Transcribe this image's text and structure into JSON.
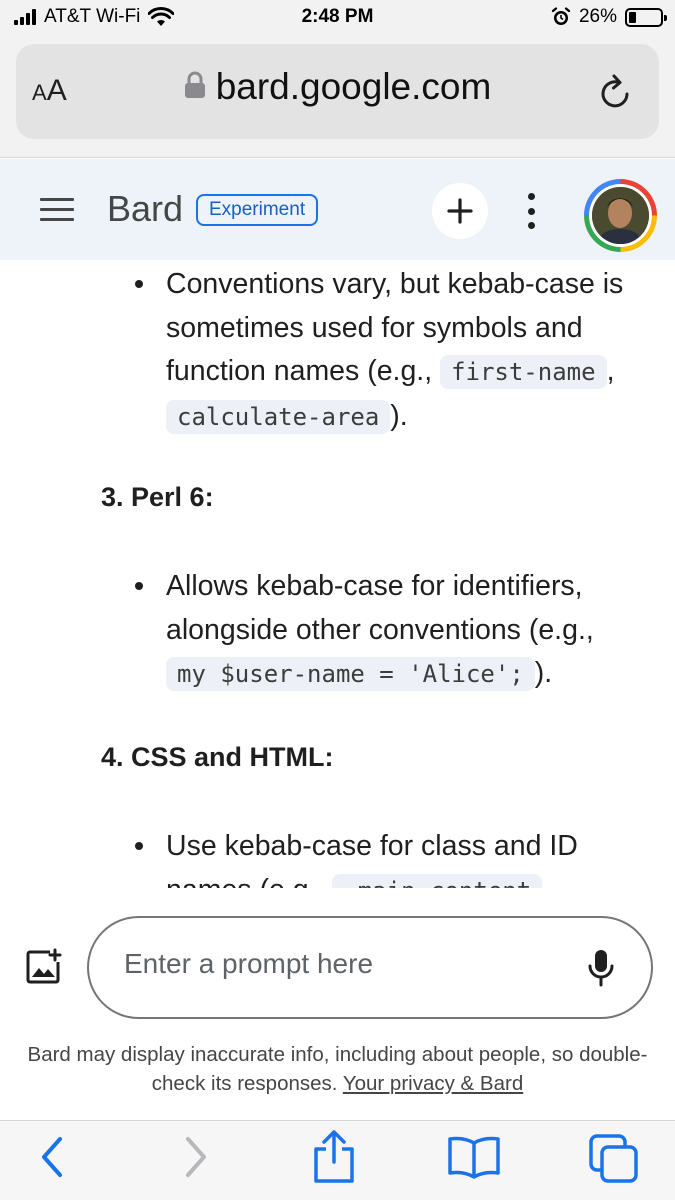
{
  "status_bar": {
    "carrier": "AT&T Wi-Fi",
    "time": "2:48 PM",
    "battery": "26%",
    "battery_level": 0.26
  },
  "address_bar": {
    "text_size_label": "AA",
    "url": "bard.google.com"
  },
  "header": {
    "logo": "Bard",
    "badge": "Experiment"
  },
  "content": {
    "bullet1": {
      "line1": "Conventions vary, but kebab-case is",
      "line2": "sometimes used for symbols and",
      "line3_pre": "function names (e.g., ",
      "code1": "first-name",
      "line3_post": ",",
      "code2": "calculate-area",
      "line4_post": ")."
    },
    "heading3": "3. Perl 6:",
    "bullet2": {
      "line1": "Allows kebab-case for identifiers,",
      "line2": "alongside other conventions (e.g.,",
      "code": "my $user-name = 'Alice';",
      "line3_post": ")."
    },
    "heading4": "4. CSS and HTML:",
    "bullet3": {
      "line1": "Use kebab-case for class and ID",
      "line2_pre": "names (e.g., ",
      "code": ".main-content"
    }
  },
  "prompt": {
    "placeholder": "Enter a prompt here"
  },
  "disclaimer": {
    "text": "Bard may display inaccurate info, including about people, so double-check its responses. ",
    "link": "Your privacy & Bard"
  },
  "colors": {
    "header_bg": "#eef2f9",
    "accent_blue": "#1a73e8",
    "toolbar_icon": "#1a73e8"
  }
}
